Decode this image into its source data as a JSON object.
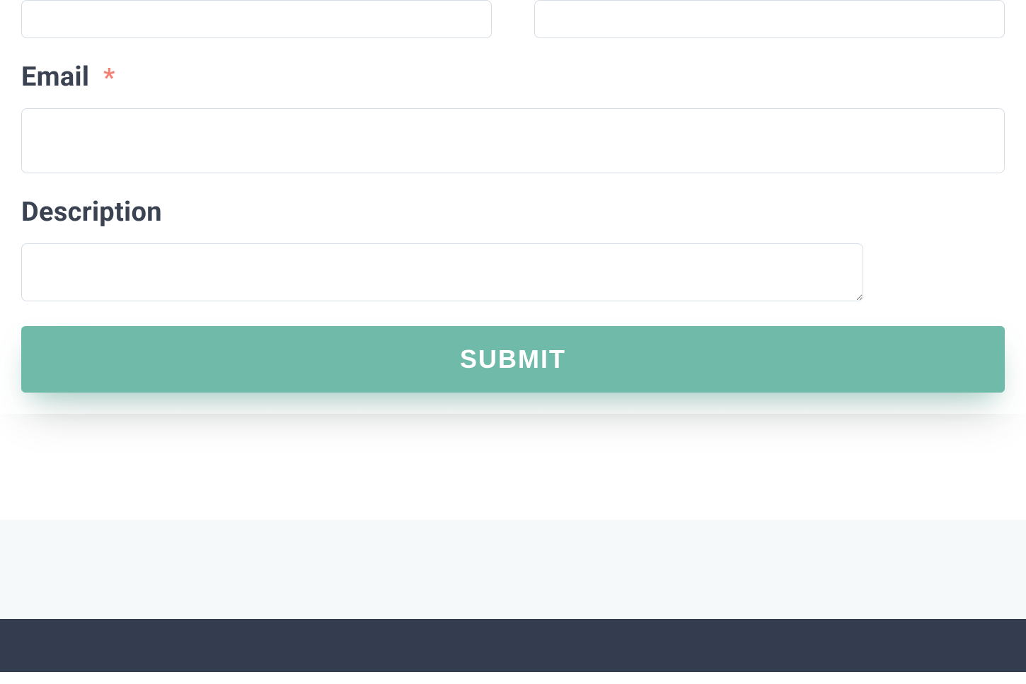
{
  "form": {
    "top_row": {
      "left_value": "",
      "right_value": ""
    },
    "email": {
      "label": "Email",
      "required_mark": "*",
      "value": ""
    },
    "description": {
      "label": "Description",
      "value": ""
    },
    "submit_label": "SUBMIT"
  }
}
